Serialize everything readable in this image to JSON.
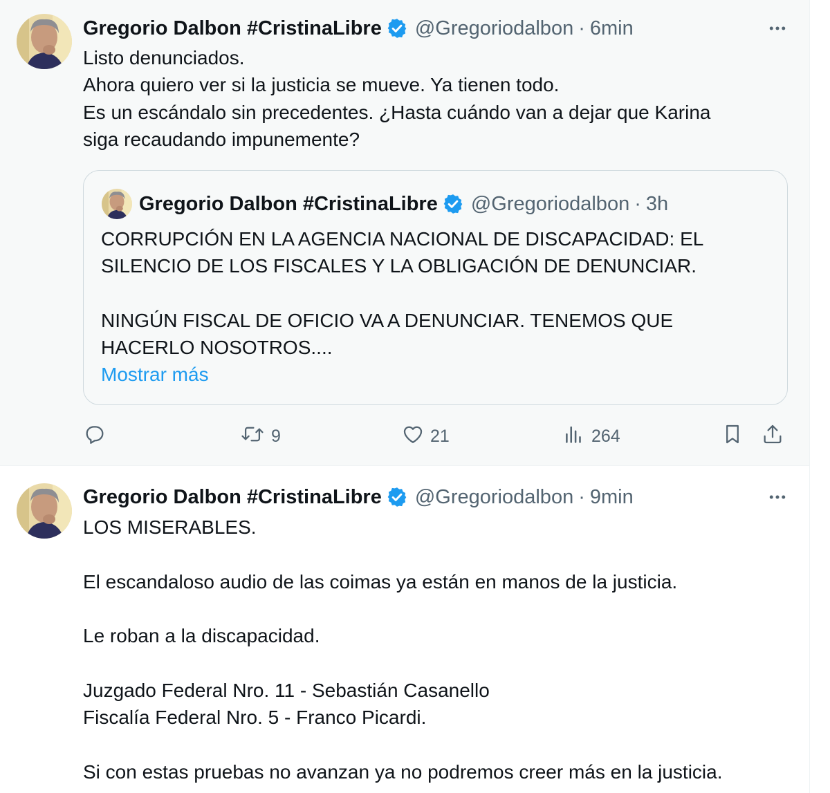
{
  "colors": {
    "text_primary": "#0f1419",
    "text_secondary": "#536471",
    "accent_blue": "#1d9bf0",
    "verified_blue": "#1d9bf0",
    "divider": "#eff3f4",
    "hover_background": "#f7f9f9"
  },
  "tweets": [
    {
      "author_name": "Gregorio Dalbon #CristinaLibre",
      "handle": "@Gregoriodalbon",
      "separator": "·",
      "time": "6min",
      "more_icon": "more-horizontal-icon",
      "verified_icon": "verified-badge-icon",
      "lines": [
        "Listo denunciados.",
        "Ahora quiero ver si la justicia se mueve. Ya tienen todo.",
        "Es un escándalo sin precedentes. ¿Hasta cuándo van a dejar que Karina",
        "siga recaudando impunemente?"
      ],
      "quote": {
        "author_name": "Gregorio Dalbon #CristinaLibre",
        "handle": "@Gregoriodalbon",
        "separator": "·",
        "time": "3h",
        "lines": [
          "CORRUPCIÓN EN LA AGENCIA NACIONAL DE DISCAPACIDAD: EL",
          "SILENCIO DE LOS FISCALES Y LA OBLIGACIÓN DE DENUNCIAR.",
          "",
          "NINGÚN FISCAL DE OFICIO VA A DENUNCIAR. TENEMOS QUE",
          "HACERLO NOSOTROS...."
        ],
        "show_more": "Mostrar más"
      },
      "actions": {
        "reply": {
          "icon": "reply-icon",
          "count": ""
        },
        "retweet": {
          "icon": "retweet-icon",
          "count": "9"
        },
        "like": {
          "icon": "like-heart-icon",
          "count": "21"
        },
        "views": {
          "icon": "views-chart-icon",
          "count": "264"
        },
        "bookmark": {
          "icon": "bookmark-icon"
        },
        "share": {
          "icon": "share-upload-icon"
        }
      }
    },
    {
      "author_name": "Gregorio Dalbon #CristinaLibre",
      "handle": "@Gregoriodalbon",
      "separator": "·",
      "time": "9min",
      "more_icon": "more-horizontal-icon",
      "verified_icon": "verified-badge-icon",
      "lines": [
        "LOS MISERABLES.",
        "",
        "El escandaloso audio de las coimas ya están en manos de la justicia.",
        "",
        "Le roban a la discapacidad.",
        "",
        "Juzgado Federal Nro. 11 - Sebastián Casanello",
        "Fiscalía Federal Nro. 5 - Franco Picardi.",
        "",
        "Si con estas pruebas no avanzan ya no podremos creer más en la justicia."
      ]
    }
  ]
}
